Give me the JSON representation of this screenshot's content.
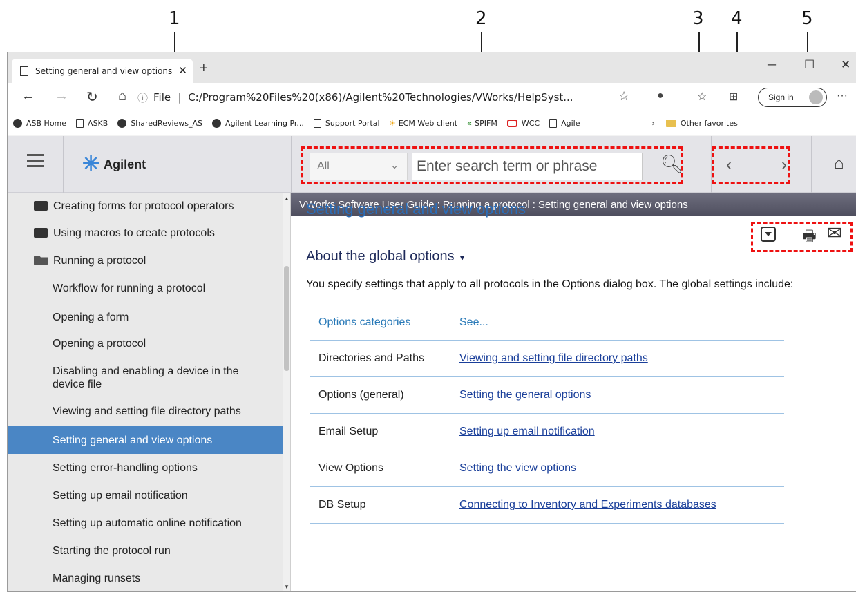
{
  "callouts": [
    "1",
    "2",
    "3",
    "4",
    "5"
  ],
  "browser": {
    "tab_title": "Setting general and view options",
    "address_prefix": "File",
    "url": "C:/Program%20Files%20(x86)/Agilent%20Technologies/VWorks/HelpSyst...",
    "sign_in": "Sign in",
    "favorites": [
      "ASB Home",
      "ASKB",
      "SharedReviews_AS",
      "Agilent Learning Pr...",
      "Support Portal",
      "ECM Web client",
      "SPIFM",
      "WCC",
      "Agile"
    ],
    "other_favorites": "Other favorites"
  },
  "help": {
    "logo_text": "Agilent",
    "search_scope": "All",
    "search_placeholder": "Enter search term or phrase"
  },
  "sidebar": {
    "folders": [
      "Creating forms for protocol operators",
      "Using macros to create protocols",
      "Running a protocol"
    ],
    "items": [
      "Workflow for running a protocol",
      "Opening a form",
      "Opening a protocol",
      "Disabling and enabling a device in the device file",
      "Viewing and setting file directory paths",
      "Setting general and view options",
      "Setting error-handling options",
      "Setting up email notification",
      "Setting up automatic online notification",
      "Starting the protocol run",
      "Managing runsets"
    ],
    "active_index": 5
  },
  "breadcrumb": {
    "root": "VWorks Software User Guide",
    "sep": ":",
    "parent": "Running a protocol ",
    "current": "Setting general and view options"
  },
  "content": {
    "title": "Setting general and view options",
    "section": "About the global options",
    "intro": "You specify settings that apply to all protocols in the Options dialog box. The global settings include:",
    "table_headers": [
      "Options categories",
      "See..."
    ],
    "rows": [
      {
        "category": "Directories and Paths",
        "link": "Viewing and setting file directory paths"
      },
      {
        "category": "Options (general)",
        "link": "Setting the general options"
      },
      {
        "category": "Email Setup",
        "link": "Setting up email notification"
      },
      {
        "category": "View Options",
        "link": "Setting the view options"
      },
      {
        "category": "DB Setup",
        "link": "Connecting to Inventory and Experiments databases"
      }
    ]
  },
  "colors": {
    "accent": "#2a6db8",
    "highlight": "#e11111",
    "active_item": "#4a86c5"
  }
}
